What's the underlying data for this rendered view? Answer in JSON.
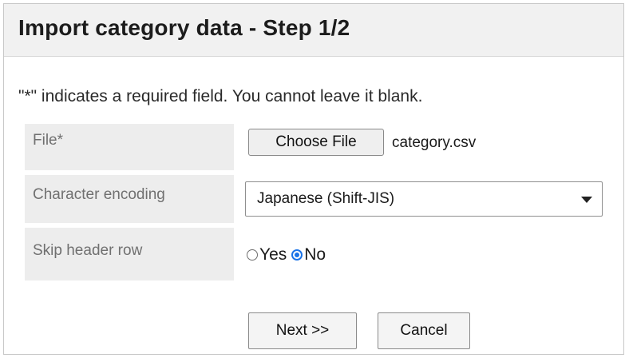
{
  "header": {
    "title": "Import category data - Step 1/2"
  },
  "note": "\"*\" indicates a required field. You cannot leave it blank.",
  "form": {
    "file": {
      "label": "File*",
      "button_label": "Choose File",
      "file_name": "category.csv"
    },
    "encoding": {
      "label": "Character encoding",
      "selected": "Japanese (Shift-JIS)"
    },
    "skip_header": {
      "label": "Skip header row",
      "options": [
        {
          "label": "Yes",
          "checked": false
        },
        {
          "label": "No",
          "checked": true
        }
      ]
    }
  },
  "actions": {
    "next_label": "Next >>",
    "cancel_label": "Cancel"
  },
  "colors": {
    "accent": "#1a73e8",
    "label_bg": "#ededed",
    "title_bg": "#f1f1f1"
  }
}
